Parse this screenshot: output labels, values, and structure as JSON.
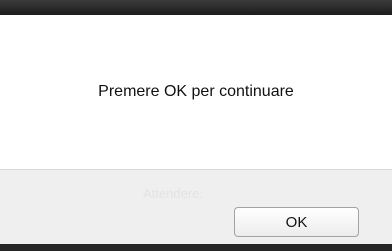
{
  "dialog": {
    "message": "Premere OK per continuare",
    "ok_label": "OK",
    "background_hint": "Attendere."
  },
  "colors": {
    "dialog_background": "#ffffff",
    "footer_background": "#efefef",
    "frame": "#2a2a2a"
  }
}
